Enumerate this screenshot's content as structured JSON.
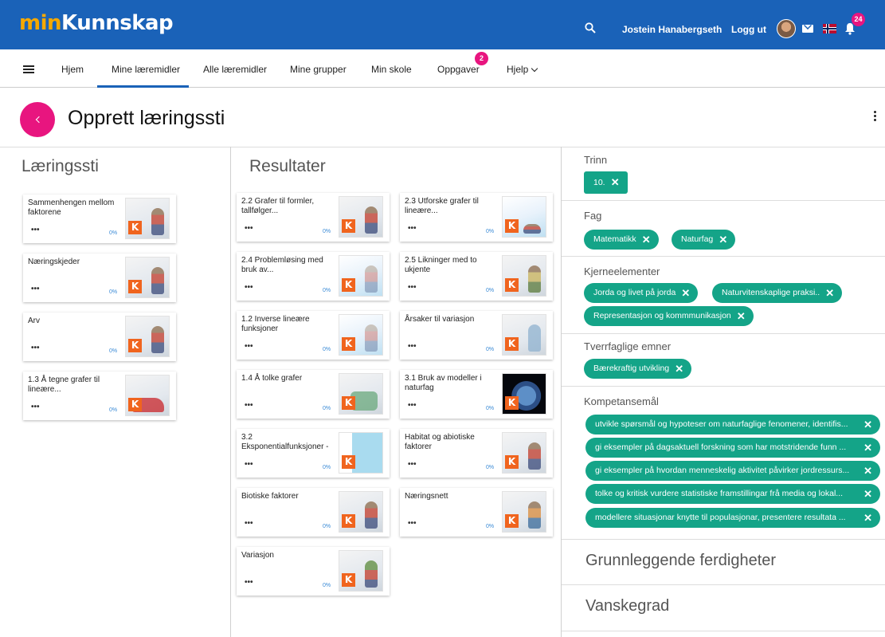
{
  "topbar": {
    "logo_part1": "min",
    "logo_part2": "Kunnskap",
    "user_name": "Jostein Hanabergseth",
    "logout": "Logg ut",
    "notification_count": "24",
    "brand_color": "#1a62b8"
  },
  "nav": {
    "items": [
      "Hjem",
      "Mine læremidler",
      "Alle læremidler",
      "Mine grupper",
      "Min skole",
      "Oppgaver",
      "Hjelp"
    ],
    "active": "Mine læremidler",
    "tasks_badge": "2"
  },
  "page": {
    "title": "Opprett læringssti",
    "accent_color": "#e8157f"
  },
  "learning_path": {
    "title": "Læringssti",
    "cards": [
      {
        "title": "Sammenhengen mellom faktorene",
        "progress": "0%",
        "image": "lion-illustration"
      },
      {
        "title": "Næringskjeder",
        "progress": "0%",
        "image": "person-illustration"
      },
      {
        "title": "Arv",
        "progress": "0%",
        "image": "family-illustration"
      },
      {
        "title": "1.3 Å tegne grafer til lineære...",
        "progress": "0%",
        "image": "car-illustration"
      }
    ]
  },
  "results": {
    "title": "Resultater",
    "cards": [
      {
        "title": "2.2 Grafer til formler, tallfølger...",
        "progress": "0%"
      },
      {
        "title": "2.3 Utforske grafer til lineære...",
        "progress": "0%"
      },
      {
        "title": "2.4 Problemløsing med bruk av...",
        "progress": "0%"
      },
      {
        "title": "2.5 Likninger med to ukjente",
        "progress": "0%"
      },
      {
        "title": "1.2 Inverse lineære funksjoner",
        "progress": "0%"
      },
      {
        "title": "Årsaker til variasjon",
        "progress": "0%"
      },
      {
        "title": "1.4 Å tolke grafer",
        "progress": "0%"
      },
      {
        "title": "3.1 Bruk av modeller i naturfag",
        "progress": "0%"
      },
      {
        "title": "3.2 Eksponentialfunksjoner -",
        "progress": "0%"
      },
      {
        "title": "Habitat og abiotiske faktorer",
        "progress": "0%"
      },
      {
        "title": "Biotiske faktorer",
        "progress": "0%"
      },
      {
        "title": "Næringsnett",
        "progress": "0%"
      },
      {
        "title": "Variasjon",
        "progress": "0%"
      }
    ]
  },
  "filters": {
    "chip_color": "#14a488",
    "trinn": {
      "label": "Trinn",
      "chips": [
        "10."
      ]
    },
    "fag": {
      "label": "Fag",
      "chips": [
        "Matematikk",
        "Naturfag"
      ]
    },
    "kjerneelementer": {
      "label": "Kjerneelementer",
      "chips": [
        "Jorda og livet på jorda",
        "Naturvitenskaplige praksi..",
        "Representasjon og kommmunikasjon"
      ]
    },
    "tverrfaglige": {
      "label": "Tverrfaglige emner",
      "chips": [
        "Bærekraftig utvikling"
      ]
    },
    "kompetansemal": {
      "label": "Kompetansemål",
      "chips": [
        "utvikle spørsmål og hypoteser om naturfaglige fenomener, identifis...",
        "gi eksempler på dagsaktuell forskning som har motstridende funn ...",
        "gi eksempler på hvordan menneskelig aktivitet påvirker jordressurs...",
        "tolke og kritisk vurdere statistiske framstillingar frå media og lokal...",
        "modellere situasjonar knytte til populasjonar, presentere resultata ..."
      ]
    },
    "grunnleggende": "Grunnleggende ferdigheter",
    "vanskegrad": "Vanskegrad"
  }
}
